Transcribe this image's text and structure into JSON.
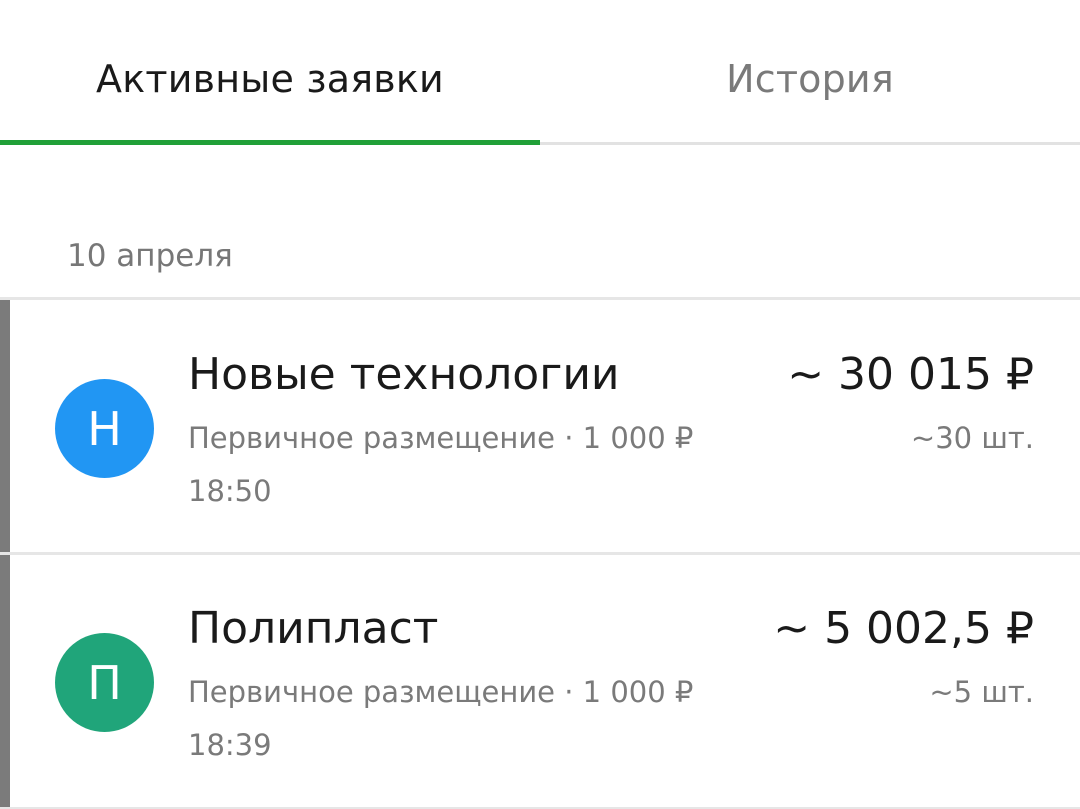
{
  "tabs": [
    {
      "label": "Активные заявки",
      "active": true
    },
    {
      "label": "История",
      "active": false
    }
  ],
  "colors": {
    "accent": "#21a038",
    "avatar_blue": "#2196f3",
    "avatar_green": "#20a57a"
  },
  "groups": [
    {
      "date": "10 апреля",
      "orders": [
        {
          "avatar_letter": "Н",
          "avatar_color": "#2196f3",
          "company": "Новые технологии",
          "description": "Первичное размещение · 1 000 ₽",
          "time": "18:50",
          "amount": "~ 30 015 ₽",
          "quantity": "~30 шт."
        },
        {
          "avatar_letter": "П",
          "avatar_color": "#20a57a",
          "company": "Полипласт",
          "description": "Первичное размещение · 1 000 ₽",
          "time": "18:39",
          "amount": "~ 5 002,5 ₽",
          "quantity": "~5 шт."
        }
      ]
    }
  ]
}
